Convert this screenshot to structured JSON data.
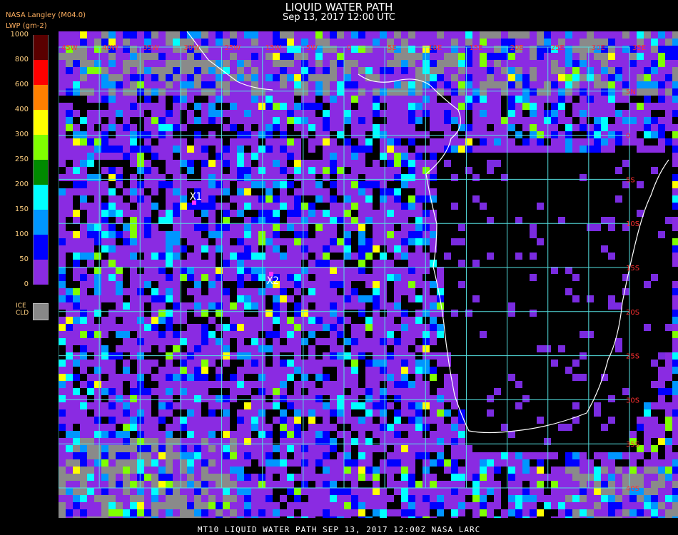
{
  "header": {
    "title": "LIQUID WATER PATH",
    "datetime": "Sep 13, 2017 12:00 UTC",
    "source": "NASA Langley (M04.0)",
    "units": "LWP (gm-2)"
  },
  "legend": {
    "ticks": [
      "1000",
      "800",
      "600",
      "400",
      "300",
      "250",
      "200",
      "150",
      "100",
      "50",
      "0"
    ],
    "colors": [
      "#5a0000",
      "#ff0000",
      "#ff7f00",
      "#ffff00",
      "#7fff00",
      "#008a00",
      "#00ffff",
      "#0096ff",
      "#0000ff",
      "#8a2be2"
    ],
    "ice_label": "ICE\nCLD",
    "ice_color": "#888888"
  },
  "map": {
    "lon_labels": [
      "45W",
      "40W",
      "35W",
      "30W",
      "25W",
      "15W",
      "5W",
      "0",
      "5E",
      "10E",
      "15E",
      "20E",
      "25E",
      "30E",
      "35E"
    ],
    "lat_labels": [
      "5N",
      "0",
      "5S",
      "10S",
      "15S",
      "20S",
      "25S",
      "30S",
      "35S",
      "40S"
    ],
    "grid_color": "#55e0e0",
    "markers": [
      {
        "label": "X1",
        "color": "#ff33ff"
      },
      {
        "label": "X2",
        "color": "#ff33ff"
      }
    ]
  },
  "footer": "MT10  LIQUID WATER PATH   SEP 13, 2017 12:00Z   NASA LARC"
}
